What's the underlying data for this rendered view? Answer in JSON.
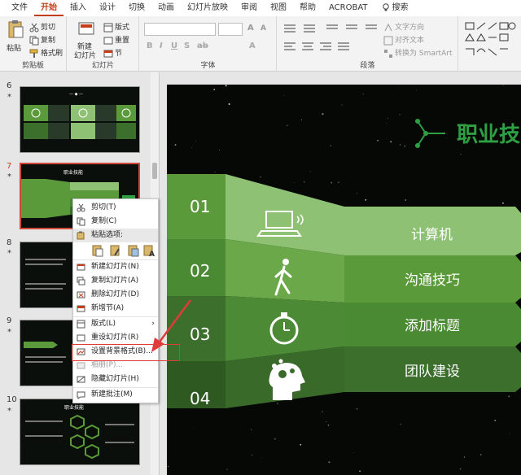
{
  "tabs": [
    "文件",
    "开始",
    "插入",
    "设计",
    "切换",
    "动画",
    "幻灯片放映",
    "审阅",
    "视图",
    "帮助",
    "ACROBAT"
  ],
  "active_tab": "开始",
  "search_label": "搜索",
  "ribbon": {
    "paste": "粘贴",
    "cut": "剪切",
    "copy": "复制",
    "format_painter": "格式刷",
    "clipboard_group": "剪贴板",
    "new_slide": "新建",
    "new_slide_2": "幻灯片",
    "layout": "版式",
    "reset": "重置",
    "section": "节",
    "slides_group": "幻灯片",
    "font_group": "字体",
    "text_direction": "文字方向",
    "align_text": "对齐文本",
    "smartart": "转换为 SmartArt",
    "paragraph_group": "段落"
  },
  "slides": [
    {
      "num": "6",
      "star": "*"
    },
    {
      "num": "7",
      "star": "*"
    },
    {
      "num": "8",
      "star": "*"
    },
    {
      "num": "9",
      "star": "*"
    },
    {
      "num": "10",
      "star": "*"
    }
  ],
  "context_menu": {
    "cut": "剪切(T)",
    "copy": "复制(C)",
    "paste_options": "粘贴选项:",
    "new_slide": "新建幻灯片(N)",
    "duplicate_slide": "复制幻灯片(A)",
    "delete_slide": "删除幻灯片(D)",
    "add_section": "新增节(A)",
    "layout": "版式(L)",
    "reset_slide": "重设幻灯片(R)",
    "format_background": "设置背景格式(B)...",
    "photo_album": "相册(P)...",
    "hide_slide": "隐藏幻灯片(H)",
    "new_comment": "新建批注(M)"
  },
  "slide_main": {
    "title": "职业技",
    "rows": [
      {
        "num": "01",
        "label": "计算机"
      },
      {
        "num": "02",
        "label": "沟通技巧"
      },
      {
        "num": "03",
        "label": "添加标题"
      },
      {
        "num": "04",
        "label": "团队建设"
      }
    ]
  },
  "thumb7_title": "职业技能",
  "thumb10_title": "职业技能",
  "thumb6_title": "工作经验",
  "colors": {
    "accent": "#c43e1c",
    "green_light": "#8fc174",
    "green_mid": "#5a9a3a",
    "green_dark": "#3c6e2c",
    "title_green": "#2ea043"
  }
}
